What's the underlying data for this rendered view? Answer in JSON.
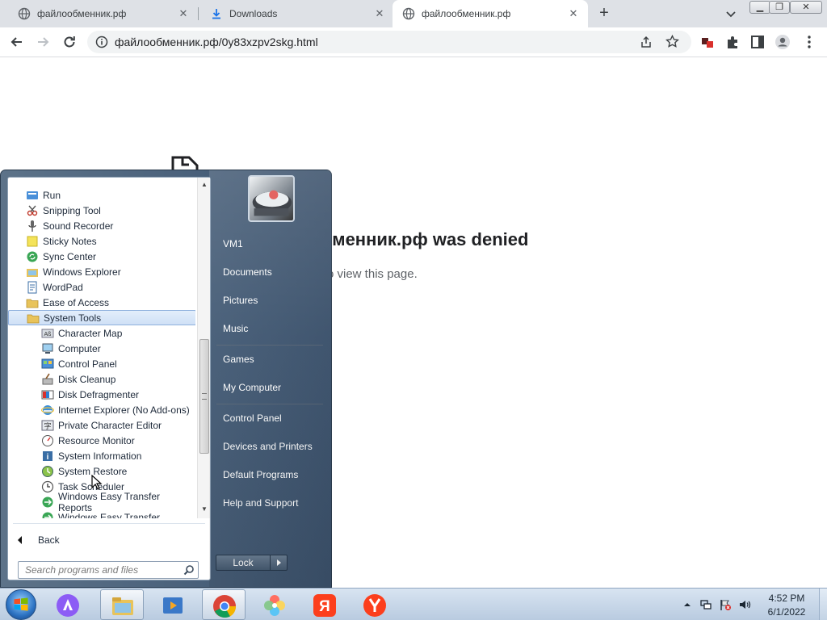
{
  "tabs": [
    {
      "title": "файлообменник.рф",
      "icon": "globe-icon",
      "active": false
    },
    {
      "title": "Downloads",
      "icon": "download-icon",
      "active": false
    },
    {
      "title": "файлообменник.рф",
      "icon": "globe-icon",
      "active": true
    }
  ],
  "toolbar": {
    "url": "файлообменник.рф/0y83xzpv2skg.html"
  },
  "page": {
    "heading": "бменник.рф was denied",
    "subtext": "o view this page."
  },
  "start_menu": {
    "programs": [
      {
        "label": "Run",
        "icon": "run-icon",
        "level": 1
      },
      {
        "label": "Snipping Tool",
        "icon": "scissors-icon",
        "level": 1
      },
      {
        "label": "Sound Recorder",
        "icon": "microphone-icon",
        "level": 1
      },
      {
        "label": "Sticky Notes",
        "icon": "sticky-note-icon",
        "level": 1
      },
      {
        "label": "Sync Center",
        "icon": "sync-icon",
        "level": 1
      },
      {
        "label": "Windows Explorer",
        "icon": "explorer-icon",
        "level": 1
      },
      {
        "label": "WordPad",
        "icon": "wordpad-icon",
        "level": 1
      },
      {
        "label": "Ease of Access",
        "icon": "folder-icon",
        "level": 1
      },
      {
        "label": "System Tools",
        "icon": "folder-icon",
        "level": 1,
        "selected": true
      },
      {
        "label": "Character Map",
        "icon": "character-map-icon",
        "level": 2
      },
      {
        "label": "Computer",
        "icon": "computer-icon",
        "level": 2
      },
      {
        "label": "Control Panel",
        "icon": "control-panel-icon",
        "level": 2
      },
      {
        "label": "Disk Cleanup",
        "icon": "disk-cleanup-icon",
        "level": 2
      },
      {
        "label": "Disk Defragmenter",
        "icon": "defragmenter-icon",
        "level": 2
      },
      {
        "label": "Internet Explorer (No Add-ons)",
        "icon": "internet-explorer-icon",
        "level": 2
      },
      {
        "label": "Private Character Editor",
        "icon": "character-editor-icon",
        "level": 2
      },
      {
        "label": "Resource Monitor",
        "icon": "resource-monitor-icon",
        "level": 2
      },
      {
        "label": "System Information",
        "icon": "system-information-icon",
        "level": 2
      },
      {
        "label": "System Restore",
        "icon": "system-restore-icon",
        "level": 2
      },
      {
        "label": "Task Scheduler",
        "icon": "task-scheduler-icon",
        "level": 2
      },
      {
        "label": "Windows Easy Transfer Reports",
        "icon": "easy-transfer-icon",
        "level": 2
      },
      {
        "label": "Windows Easy Transfer",
        "icon": "easy-transfer-icon",
        "level": 2
      }
    ],
    "back_label": "Back",
    "search_placeholder": "Search programs and files",
    "right_items": [
      "VM1",
      "Documents",
      "Pictures",
      "Music",
      "Games",
      "My Computer",
      "Control Panel",
      "Devices and Printers",
      "Default Programs",
      "Help and Support"
    ],
    "lock_label": "Lock"
  },
  "taskbar": {
    "pinned": [
      "alice-assistant-icon",
      "file-explorer-icon",
      "media-player-icon",
      "chrome-icon",
      "photo-app-icon",
      "yandex-icon",
      "yandex-browser-icon"
    ],
    "active_apps": [
      "file-explorer-icon",
      "chrome-icon"
    ],
    "time": "4:52 PM",
    "date": "6/1/2022"
  },
  "colors": {
    "start_menu_bg": "#49607a",
    "selection": "#cfe0f6",
    "taskbar": "#c6d5e6"
  }
}
